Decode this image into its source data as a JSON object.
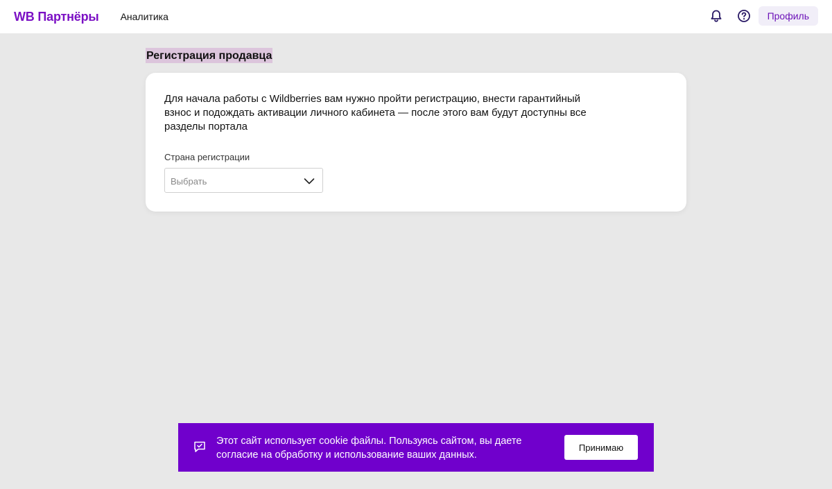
{
  "header": {
    "logo": "WB Партнёры",
    "nav_analytics": "Аналитика",
    "profile_label": "Профиль",
    "icons": [
      "bell-icon",
      "help-icon"
    ],
    "brand_color": "#7b10c4"
  },
  "main": {
    "title": "Регистрация продавца",
    "intro_text": "Для начала работы с Wildberries вам нужно пройти регистрацию, внести гарантийный взнос и подождать активации личного кабинета — после этого вам будут доступны все разделы портала",
    "country_field": {
      "label": "Страна регистрации",
      "placeholder": "Выбрать"
    }
  },
  "cookie_banner": {
    "text": "Этот сайт использует cookie файлы. Пользуясь сайтом, вы даете согласие на обработку и использование ваших данных.",
    "accept_label": "Принимаю",
    "background_color": "#7000cc"
  }
}
